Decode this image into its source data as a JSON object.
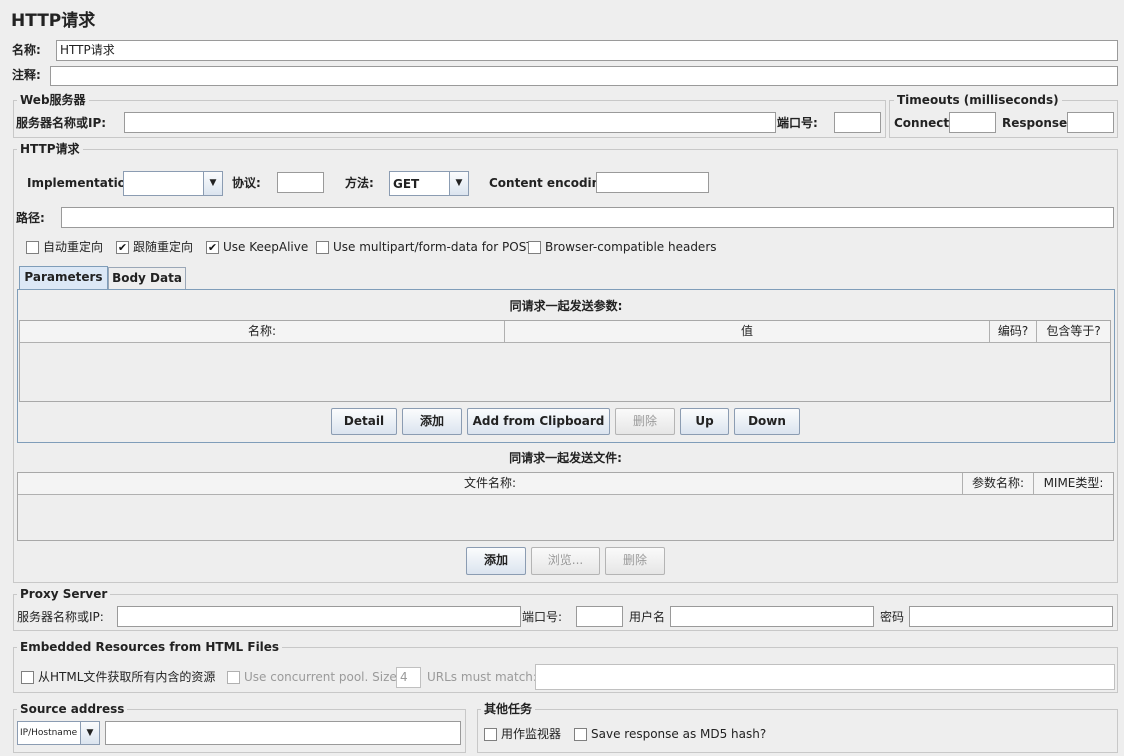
{
  "page_title": "HTTP请求",
  "name": {
    "label": "名称:",
    "value": "HTTP请求"
  },
  "comment": {
    "label": "注释:",
    "value": ""
  },
  "web_server": {
    "title": "Web服务器",
    "server_label": "服务器名称或IP:",
    "server_value": "",
    "port_label": "端口号:",
    "port_value": ""
  },
  "timeouts": {
    "title": "Timeouts (milliseconds)",
    "connect_label": "Connect:",
    "response_label": "Response:"
  },
  "http_request": {
    "title": "HTTP请求",
    "implementation_label": "Implementation:",
    "implementation_value": "",
    "protocol_label": "协议:",
    "method_label": "方法:",
    "method_value": "GET",
    "encoding_label": "Content encoding:",
    "path_label": "路径:",
    "checkboxes": [
      {
        "label": "自动重定向",
        "checked": false
      },
      {
        "label": "跟随重定向",
        "checked": true
      },
      {
        "label": "Use KeepAlive",
        "checked": true
      },
      {
        "label": "Use multipart/form-data for POST",
        "checked": false
      },
      {
        "label": "Browser-compatible headers",
        "checked": false
      }
    ],
    "check_mark": "✔"
  },
  "tabs": [
    {
      "label": "Parameters",
      "active": true
    },
    {
      "label": "Body Data",
      "active": false
    }
  ],
  "params": {
    "title": "同请求一起发送参数:",
    "columns": [
      "名称:",
      "值",
      "编码?",
      "包含等于?"
    ],
    "buttons": [
      {
        "label": "Detail",
        "enabled": true
      },
      {
        "label": "添加",
        "enabled": true
      },
      {
        "label": "Add from Clipboard",
        "enabled": true
      },
      {
        "label": "删除",
        "enabled": false
      },
      {
        "label": "Up",
        "enabled": true
      },
      {
        "label": "Down",
        "enabled": true
      }
    ]
  },
  "files": {
    "title": "同请求一起发送文件:",
    "columns": [
      "文件名称:",
      "参数名称:",
      "MIME类型:"
    ],
    "buttons": [
      {
        "label": "添加",
        "enabled": true
      },
      {
        "label": "浏览...",
        "enabled": false
      },
      {
        "label": "删除",
        "enabled": false
      }
    ]
  },
  "proxy": {
    "title": "Proxy Server",
    "server_label": "服务器名称或IP:",
    "port_label": "端口号:",
    "user_label": "用户名",
    "password_label": "密码"
  },
  "embedded": {
    "title": "Embedded Resources from HTML Files",
    "fetch_label": "从HTML文件获取所有内含的资源",
    "pool_label": "Use concurrent pool. Size:",
    "pool_size": "4",
    "urls_label": "URLs must match:"
  },
  "source_address": {
    "title": "Source address",
    "type_value": "IP/Hostname"
  },
  "other_tasks": {
    "title": "其他任务",
    "monitor_label": "用作监视器",
    "md5_label": "Save response as MD5 hash?"
  },
  "colors": {
    "background": "#eeeeee",
    "tab_panel_border": "#7f9db9",
    "active_tab": "#dce8f6"
  }
}
